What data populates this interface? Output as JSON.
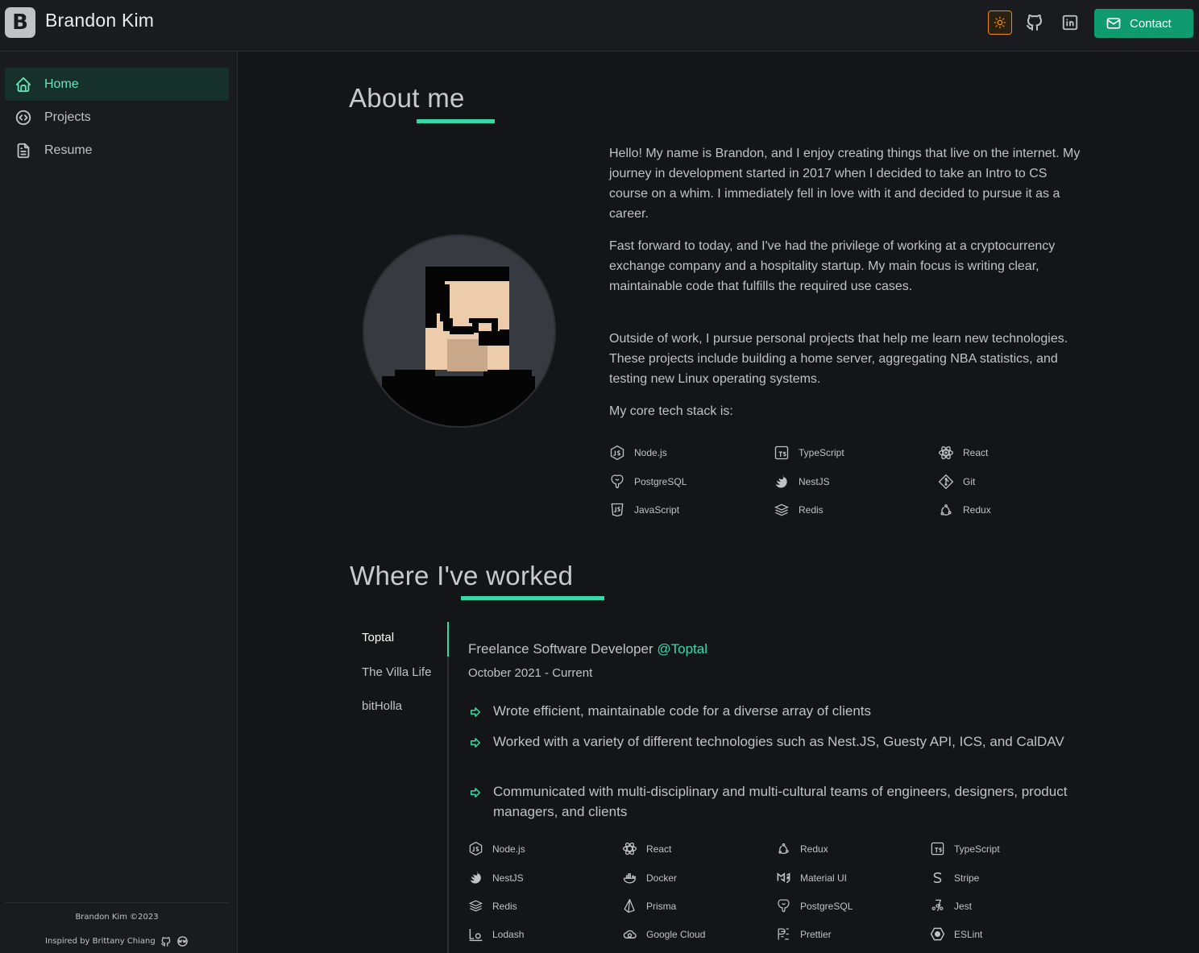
{
  "header": {
    "logo_letter": "B",
    "site_title": "Brandon Kim",
    "contact_label": "Contact",
    "accent_color": "#38d9a9",
    "theme_toggle_color": "#f08c00"
  },
  "sidebar": {
    "items": [
      {
        "label": "Home",
        "icon": "home-icon",
        "active": true
      },
      {
        "label": "Projects",
        "icon": "code-circle-icon",
        "active": false
      },
      {
        "label": "Resume",
        "icon": "file-text-icon",
        "active": false
      }
    ],
    "footer_copy": "Brandon Kim ©2023",
    "footer_inspired": "Inspired by Brittany Chiang"
  },
  "about": {
    "heading": "About me",
    "paragraphs": [
      "Hello! My name is Brandon, and I enjoy creating things that live on the internet. My journey in development started in 2017 when I decided to take an Intro to CS course on a whim. I immediately fell in love with it and decided to pursue it as a career.",
      "Fast forward to today, and I've had the privilege of working at a cryptocurrency exchange company and a hospitality startup. My main focus is writing clear, maintainable code that fulfills the required use cases.",
      "Outside of work, I pursue personal projects that help me learn new technologies. These projects include building a home server, aggregating NBA statistics, and testing new Linux operating systems.",
      "My core tech stack is:"
    ],
    "tech_stack": [
      "Node.js",
      "TypeScript",
      "React",
      "PostgreSQL",
      "NestJS",
      "Git",
      "JavaScript",
      "Redis",
      "Redux"
    ]
  },
  "work": {
    "heading": "Where I've worked",
    "tabs": [
      "Toptal",
      "The Villa Life",
      "bitHolla"
    ],
    "active_tab": "Toptal",
    "job_title": "Freelance Software Developer",
    "company": "@Toptal",
    "dates": "October 2021 - Current",
    "bullets": [
      "Wrote efficient, maintainable code for a diverse array of clients",
      "Worked with a variety of different technologies such as Nest.JS, Guesty API, ICS, and CalDAV",
      "Communicated with multi-disciplinary and multi-cultural teams of engineers, designers, product managers, and clients"
    ],
    "tech": [
      "Node.js",
      "React",
      "Redux",
      "TypeScript",
      "NestJS",
      "Docker",
      "Material UI",
      "Stripe",
      "Redis",
      "Prisma",
      "PostgreSQL",
      "Jest",
      "Lodash",
      "Google Cloud",
      "Prettier",
      "ESLint"
    ]
  }
}
